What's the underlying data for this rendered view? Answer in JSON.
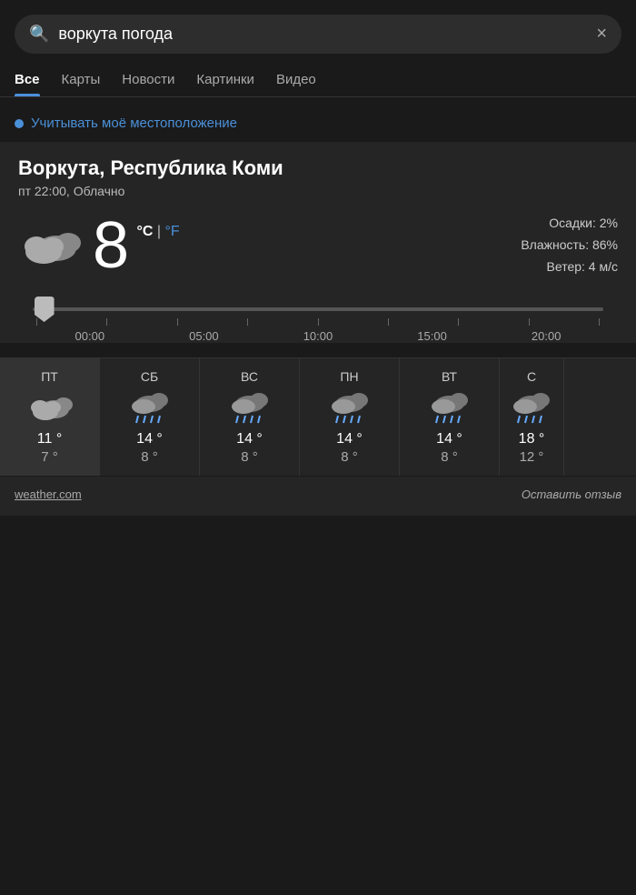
{
  "search": {
    "query": "воркута погода",
    "placeholder": "воркута погода",
    "clear_label": "×",
    "search_icon": "🔍"
  },
  "tabs": [
    {
      "id": "all",
      "label": "Все",
      "active": true
    },
    {
      "id": "maps",
      "label": "Карты",
      "active": false
    },
    {
      "id": "news",
      "label": "Новости",
      "active": false
    },
    {
      "id": "images",
      "label": "Картинки",
      "active": false
    },
    {
      "id": "video",
      "label": "Видео",
      "active": false
    }
  ],
  "location_toggle": "Учитывать моё местоположение",
  "weather": {
    "city": "Воркута, Республика Коми",
    "datetime": "пт 22:00, Облачно",
    "temperature": "8",
    "temp_unit_celsius": "°C",
    "temp_unit_sep": " | ",
    "temp_unit_f": "°F",
    "precip": "Осадки: 2%",
    "humidity": "Влажность: 86%",
    "wind": "Ветер: 4 м/с"
  },
  "timeline": {
    "labels": [
      "00:00",
      "05:00",
      "10:00",
      "15:00",
      "20:00"
    ]
  },
  "forecast": [
    {
      "day": "ПТ",
      "high": "11 °",
      "low": "7 °",
      "active": true
    },
    {
      "day": "СБ",
      "high": "14 °",
      "low": "8 °",
      "active": false
    },
    {
      "day": "ВС",
      "high": "14 °",
      "low": "8 °",
      "active": false
    },
    {
      "day": "ПН",
      "high": "14 °",
      "low": "8 °",
      "active": false
    },
    {
      "day": "ВТ",
      "high": "14 °",
      "low": "8 °",
      "active": false
    },
    {
      "day": "С",
      "high": "18 °",
      "low": "12 °",
      "active": false
    }
  ],
  "footer": {
    "source": "weather.com",
    "review": "Оставить отзыв"
  }
}
